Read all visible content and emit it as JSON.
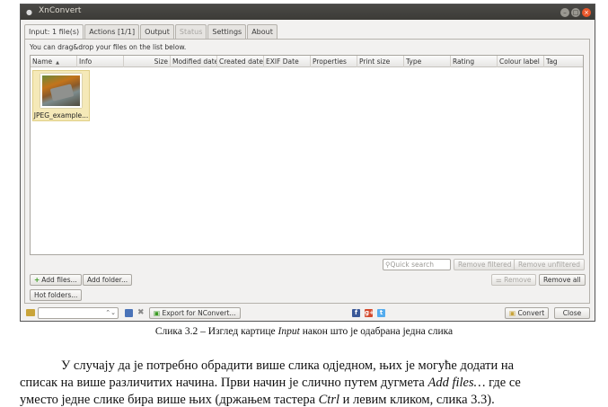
{
  "window": {
    "title": "XnConvert",
    "app_icon": "xnconvert-icon",
    "controls": {
      "minimize": "–",
      "maximize": "□",
      "close": "×"
    }
  },
  "tabs": [
    {
      "label": "Input: 1 file(s)",
      "state": "active"
    },
    {
      "label": "Actions [1/1]",
      "state": "normal"
    },
    {
      "label": "Output",
      "state": "normal"
    },
    {
      "label": "Status",
      "state": "disabled"
    },
    {
      "label": "Settings",
      "state": "normal"
    },
    {
      "label": "About",
      "state": "normal"
    }
  ],
  "input": {
    "hint": "You can drag&drop your files on the list below.",
    "columns": [
      "Name",
      "Info",
      "Size",
      "Modified date",
      "Created date",
      "EXIF Date",
      "Properties",
      "Print size",
      "Type",
      "Rating",
      "Colour label",
      "Tag"
    ],
    "files": [
      {
        "label": "JPEG_example..."
      }
    ],
    "quick_search_placeholder": "Quick search",
    "buttons": {
      "remove_filtered": "Remove filtered",
      "remove_unfiltered": "Remove unfiltered",
      "add_files": "Add files...",
      "add_folder": "Add folder...",
      "remove": "Remove",
      "remove_all": "Remove all",
      "hot_folders": "Hot folders..."
    }
  },
  "bottombar": {
    "combo_arrow": "⌃⌄",
    "export_label": "Export for NConvert...",
    "convert_label": "Convert",
    "close_label": "Close",
    "social": {
      "facebook": "f",
      "google": "g+",
      "twitter": "t"
    }
  },
  "caption": {
    "prefix": "Слика 3.2 – Изглед картице ",
    "emph": "Input",
    "suffix": " након што је одабрана једна слика"
  },
  "paragraph": {
    "line1": "У случају да је потребно обрадити више слика одједном, њих је могуће додати на",
    "line2_a": "списак на више различитих начина. Први начин је слично путем дугмета ",
    "line2_em": "Add files…",
    "line2_b": " где се",
    "line3_a": "уместо једне слике бира више њих (држањем тастера ",
    "line3_em": "Ctrl",
    "line3_b": " и левим кликом, слика 3.3)."
  }
}
